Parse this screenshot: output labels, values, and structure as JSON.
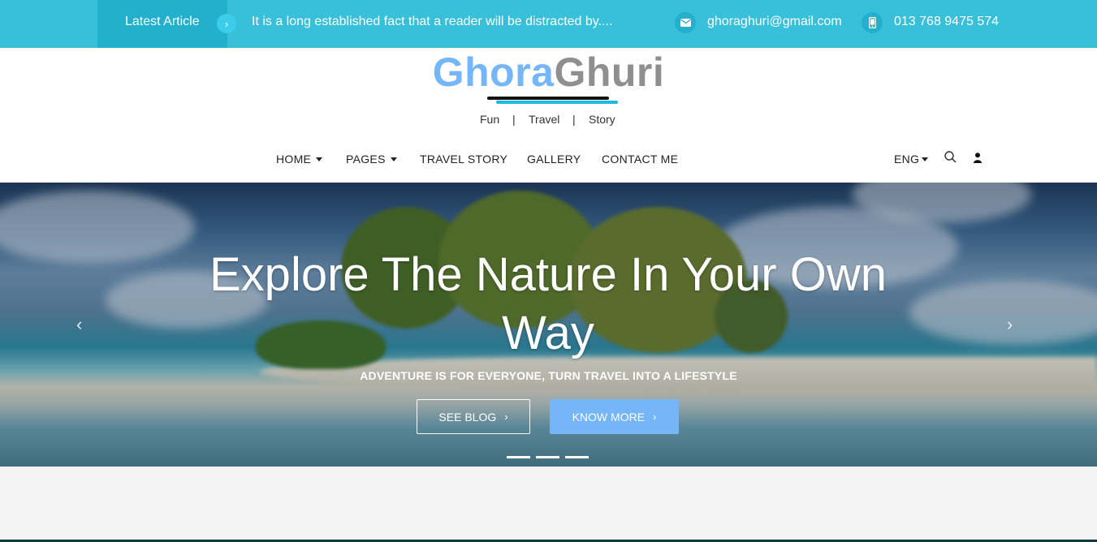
{
  "topbar": {
    "latest_label": "Latest Article",
    "latest_arrow": "›",
    "latest_text": "It is a long established fact that a reader will be distracted by....",
    "email": "ghoraghuri@gmail.com",
    "phone": "013 768 9475 574",
    "mail_icon": "mail-icon",
    "phone_icon": "mobile-phone-icon"
  },
  "brand": {
    "part1": "Ghora",
    "part2": "Ghuri",
    "color1": "#74b6f7",
    "color2": "#8f8f8f",
    "tagline": [
      "Fun",
      "Travel",
      "Story"
    ],
    "separator": "|"
  },
  "nav": {
    "items": [
      {
        "label": "HOME",
        "dropdown": true
      },
      {
        "label": "PAGES",
        "dropdown": true
      },
      {
        "label": "TRAVEL STORY",
        "dropdown": false
      },
      {
        "label": "GALLERY",
        "dropdown": false
      },
      {
        "label": "CONTACT ME",
        "dropdown": false
      }
    ],
    "language": "ENG",
    "search_icon": "search-icon",
    "user_icon": "user-icon"
  },
  "hero": {
    "title": "Explore The Nature In Your Own Way",
    "subtitle": "ADVENTURE IS FOR EVERYONE, TURN TRAVEL INTO A LIFESTYLE",
    "btn_blog": "SEE BLOG",
    "btn_more": "KNOW MORE",
    "btn_chevron": "›",
    "prev_arrow": "‹",
    "next_arrow": "›",
    "slides_count": 3,
    "active_slide": 1
  },
  "colors": {
    "topbar": "#38c0da",
    "accent": "#74b6f7",
    "underline": "#1fb8e0"
  }
}
